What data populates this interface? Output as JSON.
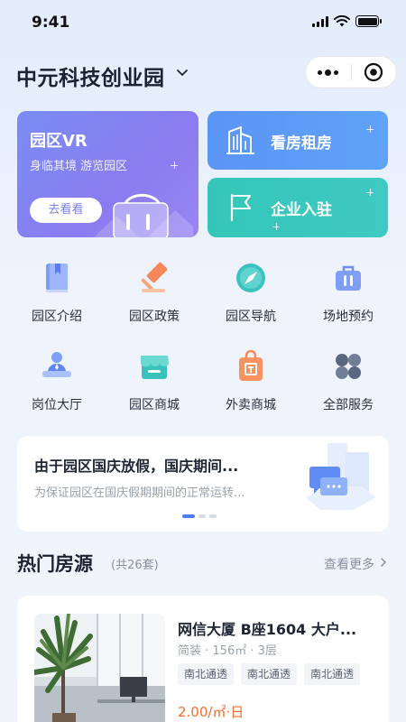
{
  "status_bar": {
    "time": "9:41"
  },
  "header": {
    "title": "中元科技创业园"
  },
  "feature_cards": {
    "vr": {
      "title": "园区VR",
      "subtitle": "身临其境 游览园区",
      "button": "去看看"
    },
    "rent": {
      "label": "看房租房"
    },
    "join": {
      "label": "企业入驻"
    }
  },
  "services": [
    {
      "label": "园区介绍",
      "icon": "book-icon"
    },
    {
      "label": "园区政策",
      "icon": "gavel-icon"
    },
    {
      "label": "园区导航",
      "icon": "compass-icon"
    },
    {
      "label": "场地预约",
      "icon": "briefcase-icon"
    },
    {
      "label": "岗位大厅",
      "icon": "person-desk-icon"
    },
    {
      "label": "园区商城",
      "icon": "store-icon"
    },
    {
      "label": "外卖商城",
      "icon": "shopping-bag-icon"
    },
    {
      "label": "全部服务",
      "icon": "grid-icon"
    }
  ],
  "notice": {
    "title": "由于园区国庆放假，国庆期间...",
    "subtitle": "为保证园区在国庆假期期间的正常运转...",
    "active_slide": 1,
    "slide_count": 3
  },
  "hot_listings": {
    "title": "热门房源",
    "count": "(共26套)",
    "more": "查看更多",
    "items": [
      {
        "name": "网信大厦 B座1604 大户...",
        "meta": "简装 · 156㎡ · 3层",
        "tags": [
          "南北通透",
          "南北通透",
          "南北通透"
        ],
        "price": "2.00/㎡·日"
      }
    ]
  },
  "colors": {
    "accent_blue": "#4c7df5",
    "vr_purple": "#8a7cf0",
    "rent_blue": "#5b95f7",
    "join_teal": "#35c6b9",
    "price_orange": "#f0702e"
  }
}
